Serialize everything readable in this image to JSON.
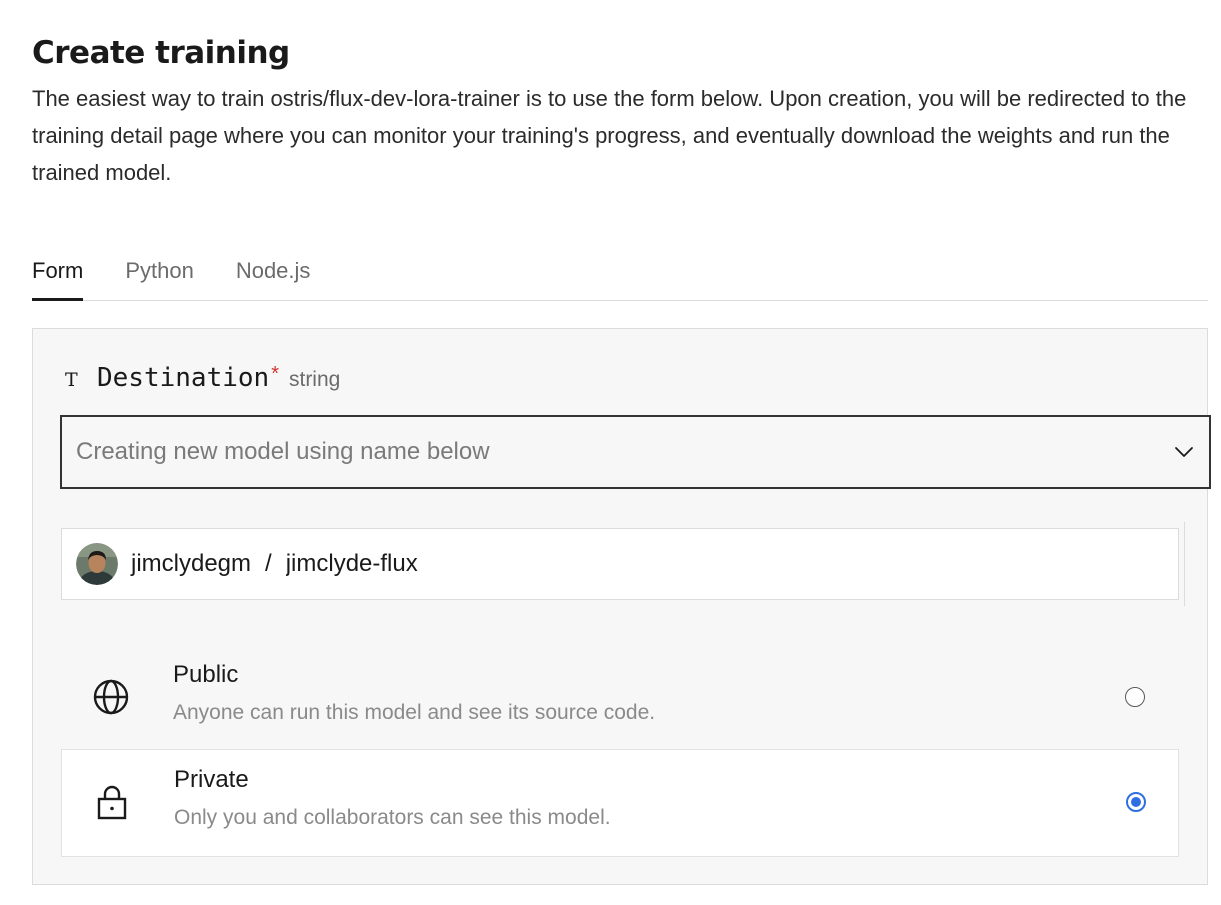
{
  "header": {
    "title": "Create training",
    "description": "The easiest way to train ostris/flux-dev-lora-trainer is to use the form below. Upon creation, you will be redirected to the training detail page where you can monitor your training's progress, and eventually download the weights and run the trained model."
  },
  "tabs": [
    {
      "label": "Form",
      "active": true
    },
    {
      "label": "Python",
      "active": false
    },
    {
      "label": "Node.js",
      "active": false
    }
  ],
  "form": {
    "destination": {
      "type_icon": "T",
      "label": "Destination",
      "required_marker": "*",
      "type": "string",
      "select_value": "Creating new model using name below"
    },
    "model": {
      "owner": "jimclydegm",
      "separator": "/",
      "name": "jimclyde-flux"
    },
    "visibility": {
      "selected": "private",
      "options": [
        {
          "id": "public",
          "icon": "globe-icon",
          "title": "Public",
          "description": "Anyone can run this model and see its source code."
        },
        {
          "id": "private",
          "icon": "lock-icon",
          "title": "Private",
          "description": "Only you and collaborators can see this model."
        }
      ]
    }
  },
  "colors": {
    "accent": "#2f6fe4",
    "required": "#d0342c",
    "panel_background": "#f7f7f7"
  }
}
